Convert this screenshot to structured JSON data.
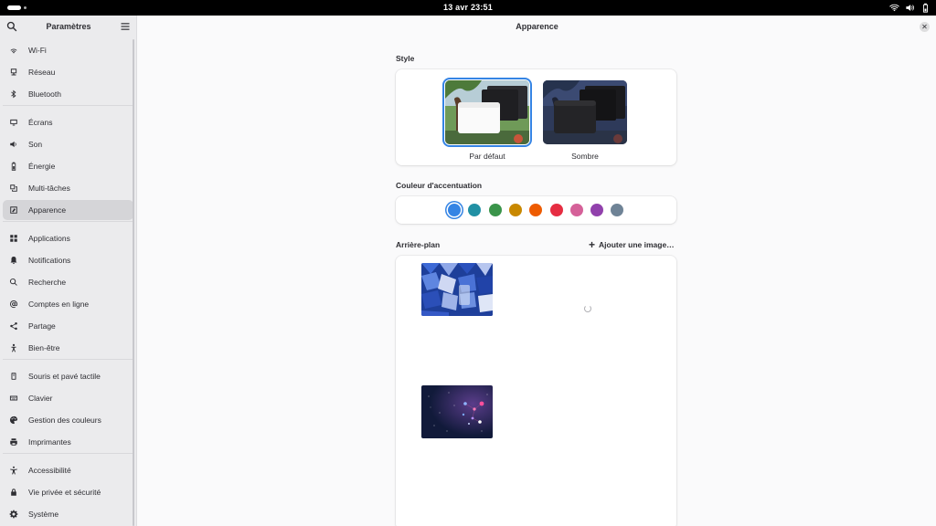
{
  "topbar": {
    "clock": "13 avr  23:51",
    "icons": [
      "wifi-icon",
      "volume-icon",
      "battery-icon"
    ]
  },
  "sidebar": {
    "title": "Paramètres",
    "items": [
      {
        "label": "Wi-Fi",
        "icon": "wifi-icon"
      },
      {
        "label": "Réseau",
        "icon": "network-icon"
      },
      {
        "label": "Bluetooth",
        "icon": "bluetooth-icon"
      },
      {
        "label": "Écrans",
        "icon": "display-icon"
      },
      {
        "label": "Son",
        "icon": "sound-icon"
      },
      {
        "label": "Énergie",
        "icon": "power-icon"
      },
      {
        "label": "Multi-tâches",
        "icon": "multitasking-icon"
      },
      {
        "label": "Apparence",
        "icon": "appearance-icon",
        "active": true
      },
      {
        "label": "Applications",
        "icon": "apps-icon"
      },
      {
        "label": "Notifications",
        "icon": "bell-icon"
      },
      {
        "label": "Recherche",
        "icon": "search-icon"
      },
      {
        "label": "Comptes en ligne",
        "icon": "at-icon"
      },
      {
        "label": "Partage",
        "icon": "share-icon"
      },
      {
        "label": "Bien-être",
        "icon": "wellbeing-icon"
      },
      {
        "label": "Souris et pavé tactile",
        "icon": "mouse-icon"
      },
      {
        "label": "Clavier",
        "icon": "keyboard-icon"
      },
      {
        "label": "Gestion des couleurs",
        "icon": "color-icon"
      },
      {
        "label": "Imprimantes",
        "icon": "printer-icon"
      },
      {
        "label": "Accessibilité",
        "icon": "accessibility-icon"
      },
      {
        "label": "Vie privée et sécurité",
        "icon": "privacy-icon"
      },
      {
        "label": "Système",
        "icon": "gear-icon"
      }
    ]
  },
  "main": {
    "title": "Apparence",
    "style": {
      "label": "Style",
      "options": [
        {
          "label": "Par défaut",
          "selected": true
        },
        {
          "label": "Sombre",
          "selected": false
        }
      ]
    },
    "accent": {
      "label": "Couleur d'accentuation",
      "colors": [
        "#3584e4",
        "#2190a4",
        "#3a944a",
        "#c88800",
        "#ed5b00",
        "#e62d42",
        "#d56199",
        "#9141ac",
        "#6f8396"
      ],
      "selected_index": 0
    },
    "background": {
      "label": "Arrière-plan",
      "add_label": "Ajouter une image…"
    }
  }
}
